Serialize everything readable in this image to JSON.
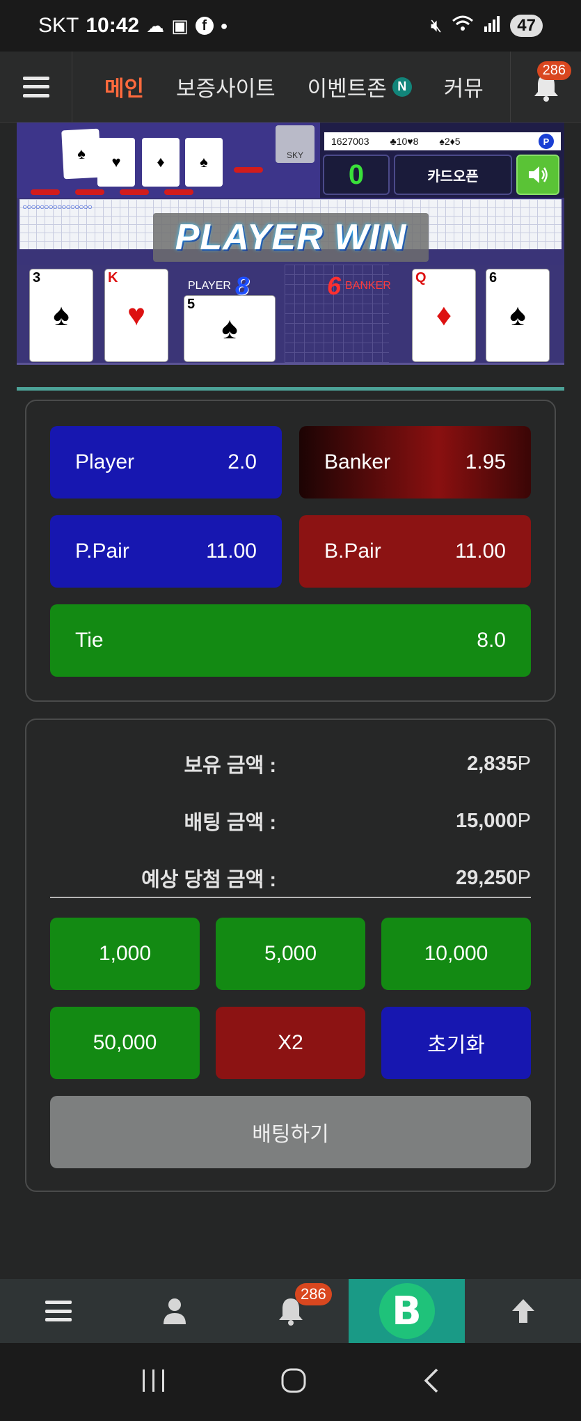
{
  "status_bar": {
    "carrier": "SKT",
    "time": "10:42",
    "battery": "47"
  },
  "top_nav": {
    "tabs": [
      {
        "label": "메인",
        "active": true
      },
      {
        "label": "보증사이트",
        "active": false
      },
      {
        "label": "이벤트존",
        "active": false,
        "badge": "N"
      },
      {
        "label": "커뮤",
        "active": false
      }
    ],
    "bell_count": "286"
  },
  "game": {
    "score_row": {
      "round": "1627003",
      "player_cards": "♣10♥8",
      "banker_cards": "♠2♦5",
      "result_badge": "P"
    },
    "score_display": "0",
    "card_open_label": "카드오픈",
    "win_banner": "PLAYER WIN",
    "player_label": "PLAYER",
    "player_score": "8",
    "banker_label": "BANKER",
    "banker_score": "6",
    "sky_label": "SKY",
    "player_cards": [
      {
        "rank": "3",
        "suit": "♠",
        "red": false
      },
      {
        "rank": "K",
        "suit": "♥",
        "red": true
      },
      {
        "rank": "5",
        "suit": "♠",
        "red": false
      }
    ],
    "banker_cards": [
      {
        "rank": "Q",
        "suit": "♦",
        "red": true
      },
      {
        "rank": "6",
        "suit": "♠",
        "red": false
      }
    ]
  },
  "odds": {
    "player": {
      "label": "Player",
      "value": "2.0"
    },
    "banker": {
      "label": "Banker",
      "value": "1.95"
    },
    "p_pair": {
      "label": "P.Pair",
      "value": "11.00"
    },
    "b_pair": {
      "label": "B.Pair",
      "value": "11.00"
    },
    "tie": {
      "label": "Tie",
      "value": "8.0"
    }
  },
  "bet_info": {
    "balance_label": "보유 금액 :",
    "balance_value": "2,835",
    "bet_label": "배팅 금액 :",
    "bet_value": "15,000",
    "expected_label": "예상 당첨 금액 :",
    "expected_value": "29,250",
    "unit": "P"
  },
  "chips": {
    "c1": "1,000",
    "c2": "5,000",
    "c3": "10,000",
    "c4": "50,000",
    "double": "X2",
    "reset": "초기화"
  },
  "submit_label": "배팅하기",
  "bottom_nav": {
    "bell_count": "286",
    "logo_letter": "B"
  },
  "colors": {
    "accent": "#ff6a3d",
    "player_blue": "#1717b0",
    "banker_red": "#8c1313",
    "tie_green": "#138a13",
    "teal": "#1a9a86"
  }
}
